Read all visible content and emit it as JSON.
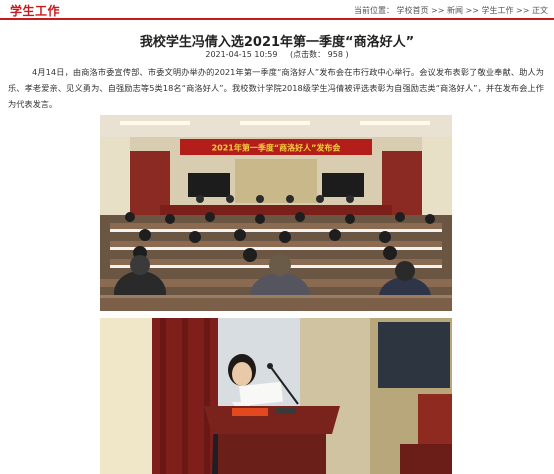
{
  "header": {
    "section_title": "学生工作",
    "breadcrumb_prefix": "当前位置：",
    "crumbs": [
      "学校首页",
      "新闻",
      "学生工作",
      "正文"
    ],
    "separator": ">>"
  },
  "article": {
    "title": "我校学生冯倩入选2021年第一季度“商洛好人”",
    "date": "2021-04-15 10:59",
    "hits_label": "(点击数：",
    "hits_value": "958",
    "hits_suffix": ")",
    "paragraph": "4月14日，由商洛市委宣传部、市委文明办举办的2021年第一季度“商洛好人”发布会在市行政中心举行。会议发布表彰了敬业奉献、助人为乐、孝老爱亲、见义勇为、自强励志等5类18名“商洛好人”。我校数计学院2018级学生冯倩被评选表彰为自强励志类“商洛好人”，并在发布会上作为代表发言。"
  },
  "photos": {
    "photo1_banner": "2021年第一季度“商洛好人”发布会"
  },
  "colors": {
    "accent": "#c8191b",
    "banner_bg": "#b31d1a",
    "banner_text": "#f4d03f"
  }
}
